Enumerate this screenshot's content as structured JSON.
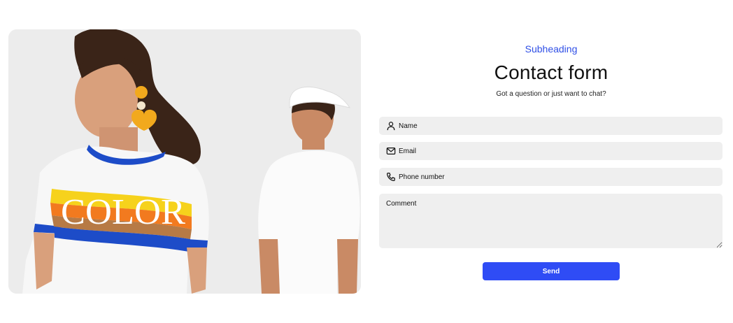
{
  "hero": {
    "image_alt": "Woman in white COLOR striped t-shirt with yellow earrings and man in white cap and t-shirt seen from behind",
    "shirt_print": "COLOR",
    "colors": {
      "background": "#ececec",
      "stripe_yellow": "#f6d21c",
      "stripe_orange": "#f27a1f",
      "stripe_brown": "#b77a45",
      "stripe_blue": "#1d4cc8"
    }
  },
  "form": {
    "subheading": "Subheading",
    "title": "Contact form",
    "tagline": "Got a question or just want to chat?",
    "fields": {
      "name": {
        "placeholder": "Name",
        "icon": "person-icon"
      },
      "email": {
        "placeholder": "Email",
        "icon": "envelope-icon"
      },
      "phone": {
        "placeholder": "Phone number",
        "icon": "phone-icon"
      },
      "comment": {
        "placeholder": "Comment"
      }
    },
    "send_label": "Send",
    "colors": {
      "accent": "#2f4cf5",
      "field_bg": "#efefef",
      "subheading": "#2f4fe6"
    }
  }
}
